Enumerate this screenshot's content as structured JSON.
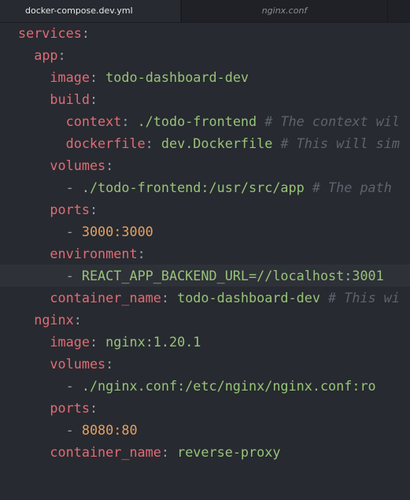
{
  "tabs": [
    {
      "label": "docker-compose.dev.yml",
      "active": true
    },
    {
      "label": "nginx.conf",
      "active": false
    }
  ],
  "lines": [
    {
      "indent": "",
      "key": "services",
      "colon": ":",
      "value": "",
      "comment": ""
    },
    {
      "indent": "  ",
      "key": "app",
      "colon": ":",
      "value": "",
      "comment": ""
    },
    {
      "indent": "    ",
      "key": "image",
      "colon": ": ",
      "value": "todo-dashboard-dev",
      "comment": ""
    },
    {
      "indent": "    ",
      "key": "build",
      "colon": ":",
      "value": "",
      "comment": ""
    },
    {
      "indent": "      ",
      "key": "context",
      "colon": ": ",
      "value": "./todo-frontend",
      "comment": " # The context wil"
    },
    {
      "indent": "      ",
      "key": "dockerfile",
      "colon": ": ",
      "value": "dev.Dockerfile",
      "comment": " # This will sim"
    },
    {
      "indent": "    ",
      "key": "volumes",
      "colon": ":",
      "value": "",
      "comment": ""
    },
    {
      "indent": "      ",
      "dash": "- ",
      "value": "./todo-frontend:/usr/src/app",
      "comment": " # The path"
    },
    {
      "indent": "    ",
      "key": "ports",
      "colon": ":",
      "value": "",
      "comment": ""
    },
    {
      "indent": "      ",
      "dash": "- ",
      "numvalue": "3000:3000",
      "comment": ""
    },
    {
      "indent": "    ",
      "key": "environment",
      "colon": ":",
      "value": "",
      "comment": ""
    },
    {
      "indent": "      ",
      "dash": "- ",
      "value": "REACT_APP_BACKEND_URL=//localhost:3001",
      "comment": "",
      "current": true
    },
    {
      "indent": "    ",
      "key": "container_name",
      "colon": ": ",
      "value": "todo-dashboard-dev",
      "comment": " # This wi"
    },
    {
      "indent": "  ",
      "key": "nginx",
      "colon": ":",
      "value": "",
      "comment": ""
    },
    {
      "indent": "    ",
      "key": "image",
      "colon": ": ",
      "value": "nginx:1.20.1",
      "comment": ""
    },
    {
      "indent": "    ",
      "key": "volumes",
      "colon": ":",
      "value": "",
      "comment": ""
    },
    {
      "indent": "      ",
      "dash": "- ",
      "value": "./nginx.conf:/etc/nginx/nginx.conf:ro",
      "comment": ""
    },
    {
      "indent": "    ",
      "key": "ports",
      "colon": ":",
      "value": "",
      "comment": ""
    },
    {
      "indent": "      ",
      "dash": "- ",
      "numvalue": "8080:80",
      "comment": ""
    },
    {
      "indent": "    ",
      "key": "container_name",
      "colon": ": ",
      "value": "reverse-proxy",
      "comment": ""
    }
  ]
}
